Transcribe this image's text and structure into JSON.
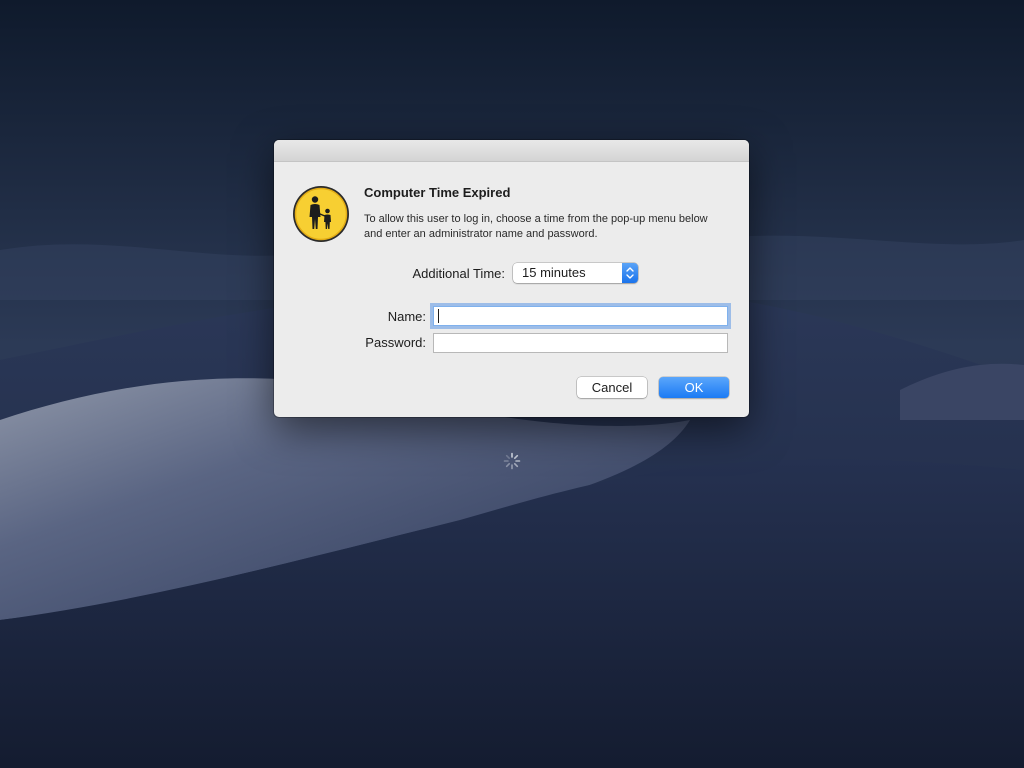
{
  "dialog": {
    "title": "Computer Time Expired",
    "message": "To allow this user to log in, choose a time from the pop-up menu below and enter an administrator name and password.",
    "icon": "parental-controls-icon",
    "additional_time": {
      "label": "Additional Time:",
      "value": "15 minutes"
    },
    "name": {
      "label": "Name:",
      "value": ""
    },
    "password": {
      "label": "Password:",
      "value": ""
    },
    "buttons": {
      "cancel": "Cancel",
      "ok": "OK"
    }
  },
  "colors": {
    "accent": "#1b7bf4",
    "icon_yellow": "#f7cf32",
    "dialog_bg": "#ececec"
  },
  "desktop": {
    "wallpaper": "mojave-night-dunes",
    "spinner_icon": "loading-spinner-icon"
  }
}
